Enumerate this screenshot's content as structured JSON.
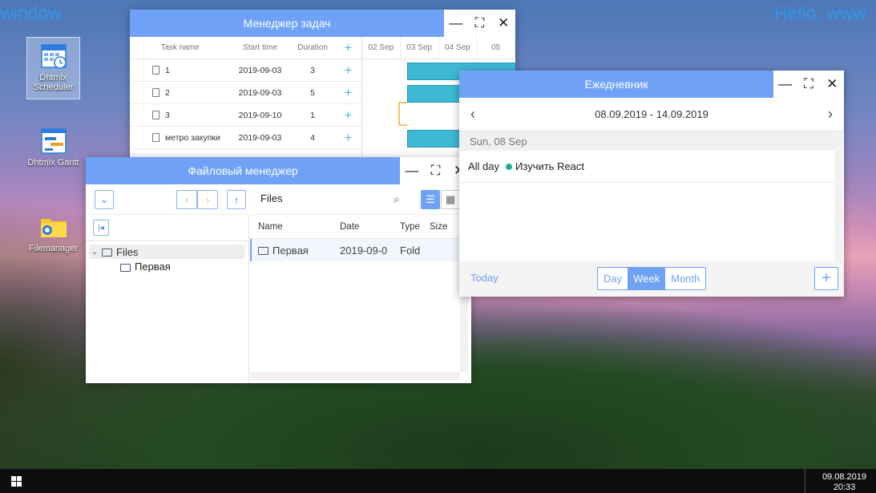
{
  "desktop": {
    "corner_left": "window",
    "corner_right": "Hello, www",
    "icons": [
      {
        "label": "Dhtmlx Scheduler",
        "icon": "calendar-icon"
      },
      {
        "label": "Dhtmlx Gantt",
        "icon": "gantt-icon"
      },
      {
        "label": "Filemanager",
        "icon": "folder-search-icon"
      }
    ]
  },
  "gantt": {
    "title": "Менеджер задач",
    "columns": [
      "Task name",
      "Start time",
      "Duration",
      "+"
    ],
    "scale": [
      "02 Sep",
      "03 Sep",
      "04 Sep",
      "05"
    ],
    "rows": [
      {
        "name": "1",
        "start": "2019-09-03",
        "duration": "3"
      },
      {
        "name": "2",
        "start": "2019-09-03",
        "duration": "5"
      },
      {
        "name": "3",
        "start": "2019-09-10",
        "duration": "1"
      },
      {
        "name": "метро закупки",
        "start": "2019-09-03",
        "duration": "4"
      }
    ]
  },
  "filemanager": {
    "title": "Файловый менеджер",
    "path": "Files",
    "tree": {
      "root": "Files",
      "child": "Первая"
    },
    "columns": [
      "Name",
      "Date",
      "Type",
      "Size"
    ],
    "files": [
      {
        "name": "Первая",
        "date": "2019-09-0",
        "type": "Fold"
      }
    ]
  },
  "scheduler": {
    "title": "Ежедневник",
    "range": "08.09.2019 - 14.09.2019",
    "day_header": "Sun, 08 Sep",
    "all_day_label": "All day",
    "event": "Изучить React",
    "today": "Today",
    "views": [
      "Day",
      "Week",
      "Month"
    ],
    "active_view": "Week",
    "add": "+"
  },
  "window_controls": {
    "minimize": "—",
    "maximize": "⛶",
    "close": "✕"
  },
  "taskbar": {
    "date": "09.08.2019",
    "time": "20:33"
  },
  "colors": {
    "accent": "#6fa2f7",
    "bar": "#3db9d3",
    "event_dot": "#1ab394",
    "corner_text": "#2f96e8"
  }
}
